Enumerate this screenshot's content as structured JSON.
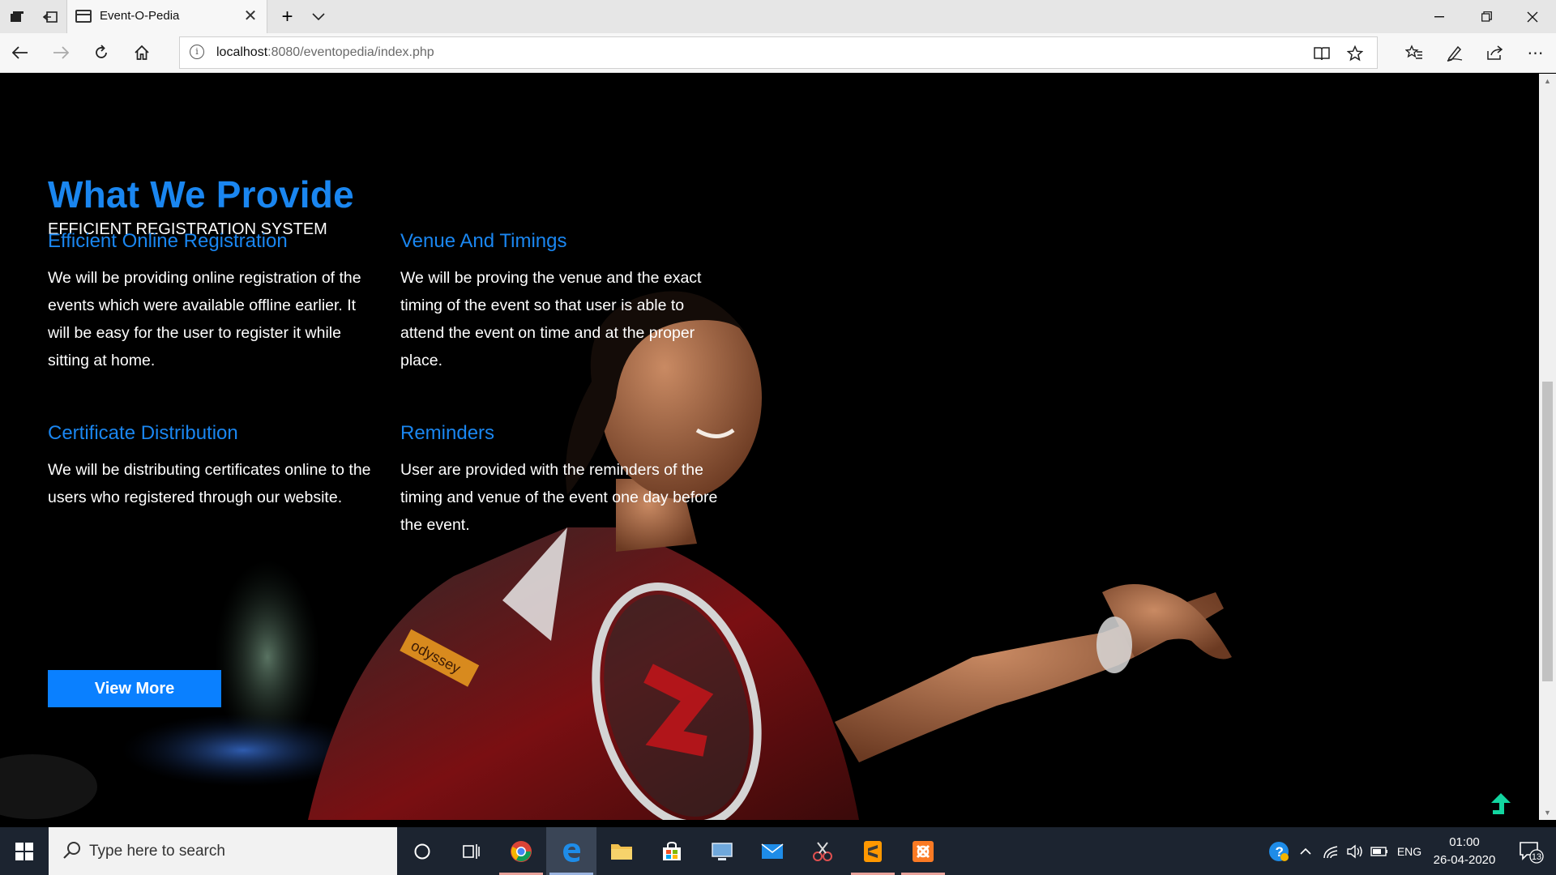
{
  "browser": {
    "tab_title": "Event-O-Pedia",
    "url_host": "localhost",
    "url_path": ":8080/eventopedia/index.php"
  },
  "page": {
    "section_title": "What We Provide",
    "section_subtitle": "EFFICIENT REGISTRATION SYSTEM",
    "features": [
      {
        "title": "Efficient Online Registration",
        "text": "We will be providing online registration of the events which were available offline earlier. It will be easy for the user to register it while sitting at home."
      },
      {
        "title": "Venue And Timings",
        "text": "We will be proving the venue and the exact timing of the event so that user is able to attend the event on time and at the proper place."
      },
      {
        "title": "Certificate Distribution",
        "text": "We will be distributing certificates online to the users who registered through our website."
      },
      {
        "title": "Reminders",
        "text": "User are provided with the reminders of the timing and venue of the event one day before the event."
      }
    ],
    "view_more_label": "View More",
    "shirt_text": "odyssey"
  },
  "taskbar": {
    "search_placeholder": "Type here to search",
    "language": "ENG",
    "time": "01:00",
    "date": "26-04-2020",
    "notification_count": "13"
  },
  "colors": {
    "accent": "#1a86f0",
    "button": "#0a80ff",
    "taskbar": "#1c2430"
  }
}
